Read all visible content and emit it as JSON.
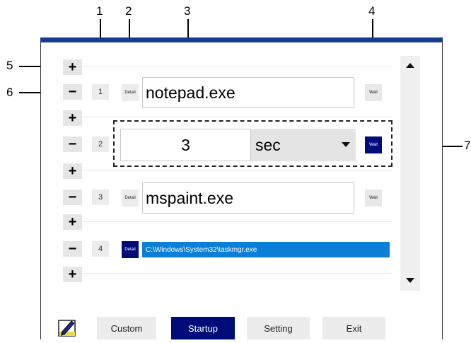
{
  "callouts": {
    "n1": "1",
    "n2": "2",
    "n3": "3",
    "n4": "4",
    "n5": "5",
    "n6": "6",
    "n7": "7"
  },
  "rows": [
    {
      "number": "1",
      "detail": "Detail",
      "path": "notepad.exe",
      "wait": "Wait"
    },
    {
      "number": "2",
      "wait_value": "3",
      "unit": "sec",
      "wait": "Wait"
    },
    {
      "number": "3",
      "detail": "Detail",
      "path": "mspaint.exe",
      "wait": "Wait"
    },
    {
      "number": "4",
      "detail": "Detail",
      "path": "C:\\Windows\\System32\\taskmgr.exe"
    }
  ],
  "controls": {
    "plus": "+",
    "minus": "−"
  },
  "tabs": {
    "custom": "Custom",
    "startup": "Startup",
    "setting": "Setting",
    "exit": "Exit"
  },
  "colors": {
    "accent": "#000b7a",
    "selection": "#0a7fd8",
    "titlebar": "#163c8f"
  }
}
